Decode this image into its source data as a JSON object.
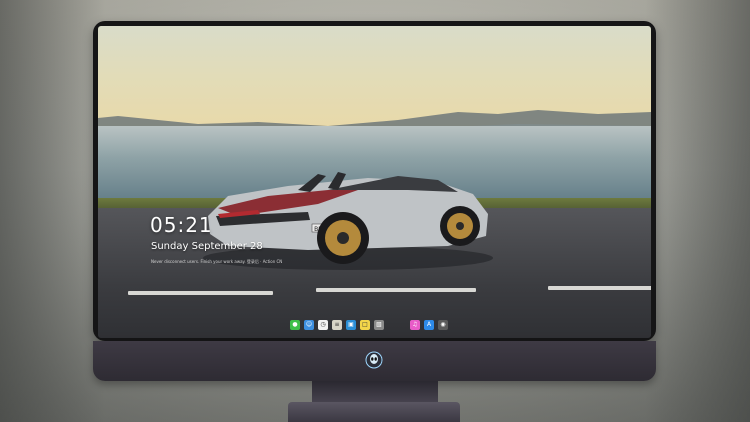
{
  "lockscreen": {
    "time": "05:21",
    "date": "Sunday September  28",
    "notice": "Never disconnect users. Finish your work away. 登录后 · Action CN"
  },
  "dock": {
    "apps": [
      {
        "name": "messages-icon",
        "color": "#3fbf4a",
        "glyph": "●"
      },
      {
        "name": "finder-icon",
        "color": "#3d8fe0",
        "glyph": "☺"
      },
      {
        "name": "clock-icon",
        "color": "#f2f2f2",
        "glyph": "◷"
      },
      {
        "name": "notes-icon",
        "color": "#d8d5c8",
        "glyph": "≡"
      },
      {
        "name": "claquette-icon",
        "color": "#2b8fd6",
        "glyph": "▣"
      },
      {
        "name": "stickies-icon",
        "color": "#f3d54a",
        "glyph": "□"
      },
      {
        "name": "photos-icon",
        "color": "#8a8a8a",
        "glyph": "▧"
      },
      {
        "name": "itunes-icon",
        "color": "#e85cc8",
        "glyph": "♫"
      },
      {
        "name": "app-store-icon",
        "color": "#2d8ae8",
        "glyph": "A"
      },
      {
        "name": "camera-icon",
        "color": "#5b5b5b",
        "glyph": "◉"
      }
    ]
  },
  "car": {
    "plate": "BN 1996"
  },
  "colors": {
    "bezel": "#151516",
    "chin": "#3e3a44",
    "stand": "#4a4652"
  }
}
